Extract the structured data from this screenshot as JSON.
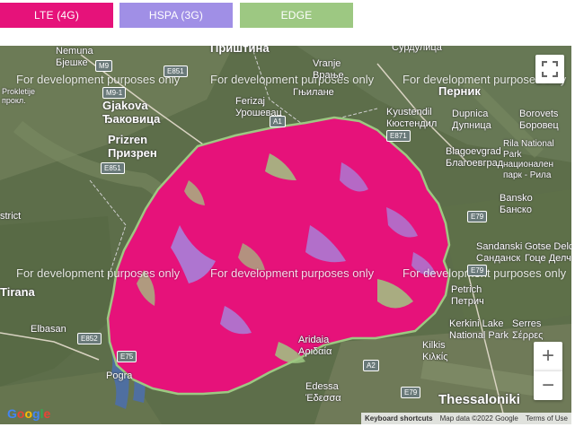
{
  "legend": [
    {
      "label": "LTE (4G)",
      "color": "#e6127a"
    },
    {
      "label": "HSPA (3G)",
      "color": "#a08fe6"
    },
    {
      "label": "EDGE",
      "color": "#9dc882"
    }
  ],
  "watermark": "For development purposes only",
  "places": {
    "nemuna_bjeshke": "Nemuna\nБјешке",
    "pristina": "Приштина",
    "vranje": "Vranje\nВрање",
    "surdulica": "Сурдулица",
    "pernik": "Перник",
    "gjakova": "Gjakova\nЂаковица",
    "prokletije": "Prokletije\nпрокл.",
    "ferizaj": "Ferizaj\nУрошевац",
    "gjilane": "Гњилане",
    "kyustendil": "Kyustendil\nКюстендил",
    "dupnica": "Dupnica\nДупница",
    "borovets": "Borovets\nБоровец",
    "prizren": "Prizren\nПризрен",
    "rila": "Rila National\nPark\nнационален\nпарк - Рила",
    "blagoevgrad": "Blagoevgrad\nБлагоевград",
    "bansko": "Bansko\nБанско",
    "district": "strict",
    "sandanski": "Sandanski\nСанданск",
    "gotse": "Gotse Delc\nГоце Делч",
    "tirana": "Tirana",
    "petrich": "Petrich\nПетрич",
    "elbasan": "Elbasan",
    "kerkini": "Kerkini Lake\nNational Park",
    "serres": "Serres\nΣέρρες",
    "kilkis": "Kilkis\nΚιλκίς",
    "arideia": "Aridaia\nΑριδαία",
    "pogradec": "Pogra",
    "edessa": "Edessa\nΈδεσσα",
    "thessaloniki": "Thessaloniki"
  },
  "road_shields": [
    "M9",
    "E851",
    "M9-1",
    "A1",
    "E871",
    "E851",
    "E79",
    "E79",
    "E852",
    "A2",
    "E75",
    "E79"
  ],
  "controls": {
    "fullscreen_icon": "fullscreen-icon",
    "zoom_in": "+",
    "zoom_out": "−"
  },
  "attribution": {
    "shortcuts": "Keyboard shortcuts",
    "map_data": "Map data ©2022 Google",
    "terms": "Terms of Use"
  },
  "google_logo": "Google"
}
